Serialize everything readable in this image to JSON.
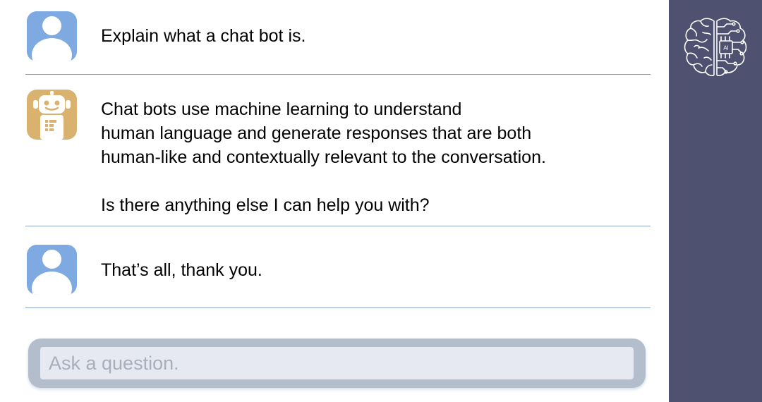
{
  "messages": [
    {
      "role": "user",
      "avatar_icon": "user-avatar-icon",
      "lines": [
        "Explain what a chat bot is."
      ]
    },
    {
      "role": "bot",
      "avatar_icon": "robot-avatar-icon",
      "lines": [
        "Chat bots use machine learning to understand",
        "human language and generate responses that are both",
        "human-like and contextually relevant to the conversation.",
        "",
        "Is there anything else I can help you with?"
      ]
    },
    {
      "role": "user",
      "avatar_icon": "user-avatar-icon",
      "lines": [
        "That’s all, thank you."
      ]
    }
  ],
  "input": {
    "placeholder": "Ask a question.",
    "value": ""
  },
  "sidebar": {
    "logo_icon": "ai-brain-icon",
    "logo_text": "AI"
  },
  "colors": {
    "sidebar_bg": "#4e5270",
    "user_avatar": "#7ea9e1",
    "bot_avatar": "#d9b26f",
    "divider": "#8aa2c4",
    "input_frame": "#b3bdcb",
    "input_bg": "#e6e9f1"
  }
}
